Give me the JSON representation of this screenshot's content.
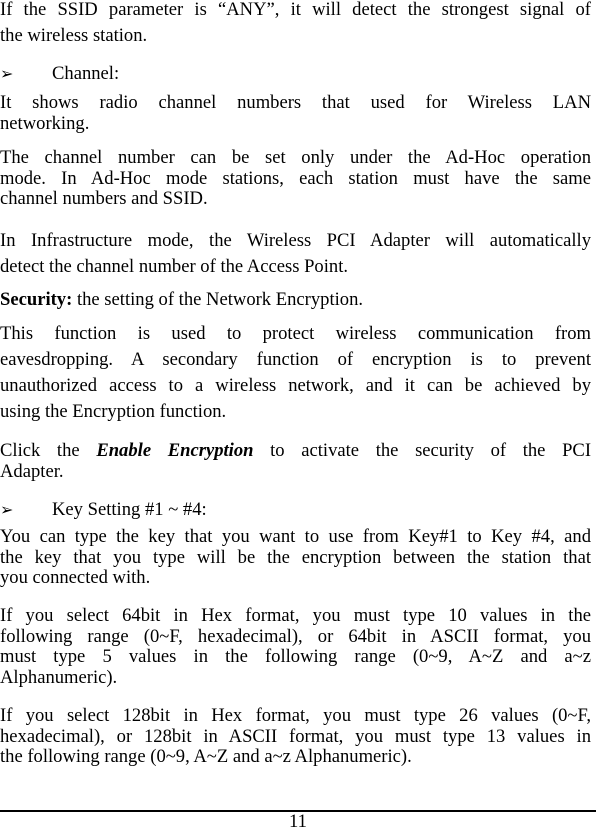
{
  "document": {
    "p_ssid": [
      "If the SSID parameter is “ANY”, it will detect the strongest signal of",
      "the wireless station."
    ],
    "bullet_channel": {
      "icon": "arrowhead-bullet",
      "glyph": "➢",
      "label": "Channel:"
    },
    "p_channel_shows": [
      "It shows radio channel numbers that used for Wireless LAN",
      "networking."
    ],
    "p_channel_adhoc": [
      "The channel number can be set only under the Ad-Hoc operation",
      "mode. In Ad-Hoc mode stations, each station must have the same",
      "channel numbers and SSID."
    ],
    "p_infrastructure": [
      "In Infrastructure mode, the Wireless PCI Adapter will automatically",
      "detect the channel number of the Access Point."
    ],
    "security": {
      "label": "Security:",
      "text": " the setting of the Network Encryption."
    },
    "p_function": [
      "This function is used to protect wireless communication from",
      "eavesdropping. A secondary function of encryption is to prevent",
      "unauthorized access to a wireless network, and it can be achieved by",
      "using the Encryption function."
    ],
    "p_click": {
      "before": "Click the ",
      "emphasis": "Enable Encryption",
      "after": " to activate the security of the PCI",
      "line2": "Adapter."
    },
    "bullet_key": {
      "icon": "arrowhead-bullet",
      "glyph": "➢",
      "label": "Key Setting #1 ~ #4:"
    },
    "p_key_type": [
      "You can type the key that you want to use from Key#1 to Key #4, and",
      "the key that you type will be the encryption between the station that",
      "you connected with."
    ],
    "p_64bit": [
      "If you select 64bit in Hex format, you must type 10 values in the",
      "following range (0~F, hexadecimal), or 64bit in ASCII format, you",
      "must type 5 values in the following range (0~9, A~Z and a~z",
      "Alphanumeric)."
    ],
    "p_128bit": [
      "If you select 128bit in Hex format, you must type 26 values (0~F,",
      "hexadecimal), or 128bit in ASCII format, you must type 13 values in",
      "the following range (0~9, A~Z and a~z Alphanumeric)."
    ]
  },
  "footer": {
    "page_number": "11"
  }
}
